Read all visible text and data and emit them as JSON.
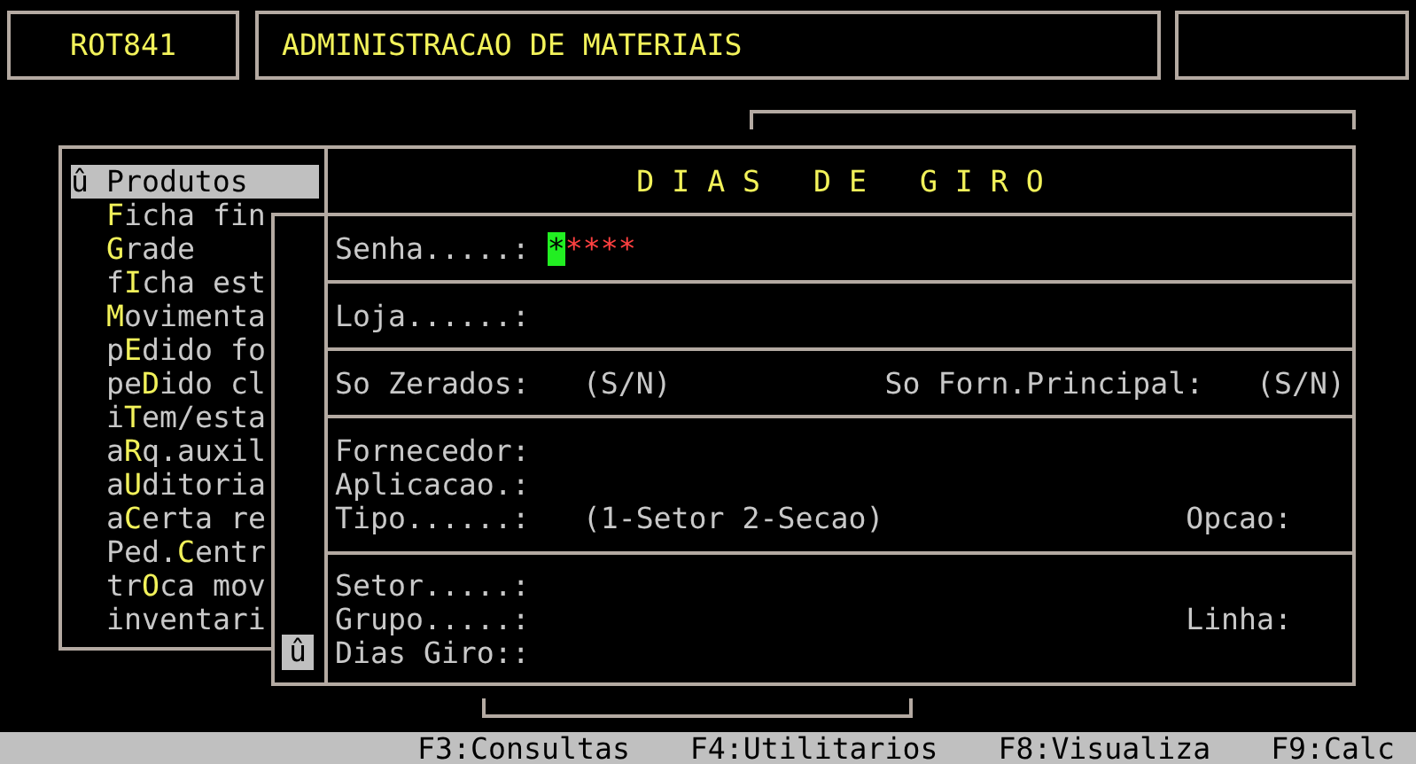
{
  "header": {
    "program_code": "ROT841",
    "title": "ADMINISTRACAO DE MATERIAIS"
  },
  "menu": {
    "items": [
      {
        "pre": "û Produtos",
        "selected": true
      },
      {
        "key": "F",
        "post": "icha fin",
        "selected": false
      },
      {
        "key": "G",
        "post": "rade",
        "selected": false
      },
      {
        "pre": "f",
        "key": "I",
        "post": "cha est",
        "selected": false
      },
      {
        "key": "M",
        "post": "ovimenta",
        "selected": false
      },
      {
        "pre": "p",
        "key": "E",
        "post": "dido fo",
        "selected": false
      },
      {
        "pre": "pe",
        "key": "D",
        "post": "ido cl",
        "selected": false
      },
      {
        "pre": "i",
        "key": "T",
        "post": "em/esta",
        "selected": false
      },
      {
        "pre": "a",
        "key": "R",
        "post": "q.auxil",
        "selected": false
      },
      {
        "pre": "a",
        "key": "U",
        "post": "ditoria",
        "selected": false
      },
      {
        "pre": "a",
        "key": "C",
        "post": "erta re",
        "selected": false
      },
      {
        "pre": "Ped.",
        "key": "C",
        "post": "entr",
        "selected": false
      },
      {
        "pre": "tr",
        "key": "O",
        "post": "ca mov",
        "selected": false
      },
      {
        "pre": "inventari",
        "selected": false
      }
    ]
  },
  "submenu": {
    "marker": "û"
  },
  "dialog": {
    "title": "D I A S   D E   G I R O",
    "sections": [
      {
        "lines": [
          {
            "label": "Senha.....:",
            "password": "*****"
          }
        ]
      },
      {
        "lines": [
          {
            "label": "Loja......:"
          }
        ]
      },
      {
        "lines": [
          {
            "label": "So Zerados:",
            "hint": "(S/N)",
            "right_label": "So Forn.Principal:",
            "right_hint": "(S/N)"
          }
        ]
      },
      {
        "lines": [
          {
            "label": "Fornecedor:"
          },
          {
            "label": "Aplicacao.:"
          },
          {
            "label": "Tipo......:",
            "hint": "(1-Setor 2-Secao)",
            "right_label": "Opcao:"
          }
        ]
      },
      {
        "lines": [
          {
            "label": "Setor.....:"
          },
          {
            "label": "Grupo.....:",
            "right_label": "Linha:"
          },
          {
            "label": "Dias Giro::"
          }
        ]
      }
    ]
  },
  "status_bar": [
    "F3:Consultas",
    "F4:Utilitarios",
    "F8:Visualiza",
    "F9:Calc"
  ]
}
